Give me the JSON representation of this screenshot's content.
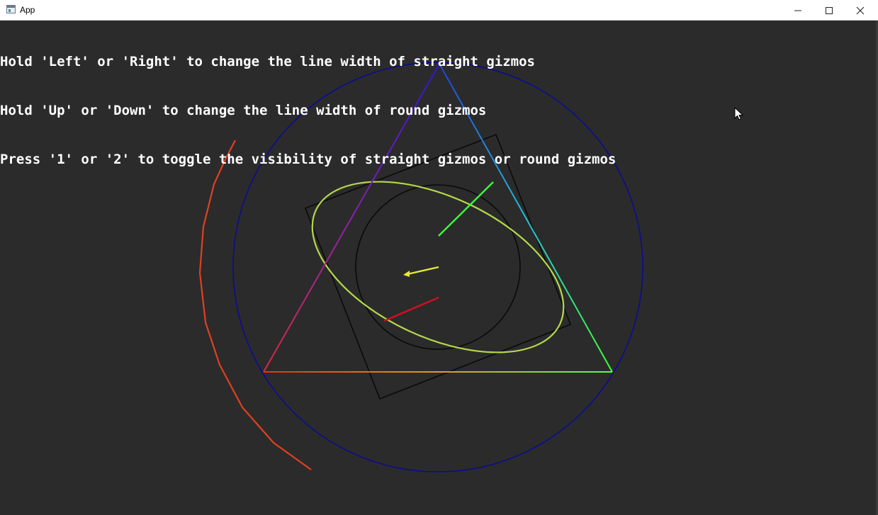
{
  "window": {
    "title": "App",
    "controls": {
      "minimize_icon": "minimize-icon",
      "maximize_icon": "maximize-icon",
      "close_icon": "close-icon"
    }
  },
  "instructions": [
    "Hold 'Left' or 'Right' to change the line width of straight gizmos",
    "Hold 'Up' or 'Down' to change the line width of round gizmos",
    "Press '1' or '2' to toggle the visibility of straight gizmos or round gizmos"
  ],
  "colors": {
    "background": "#2b2b2b",
    "text": "#ffffff",
    "big_circle": "#0a0a8a",
    "square": "#0a0a0a",
    "inner_circle": "#0a0a0a",
    "ellipse": "#b5d84a",
    "arc": "#e04020",
    "axis_green": "#3aff3a",
    "axis_yellow": "#e8e83a",
    "axis_red": "#d01020",
    "triangle_top": "#2020d0",
    "triangle_left": "#e03020",
    "triangle_right": "#40ff40"
  }
}
